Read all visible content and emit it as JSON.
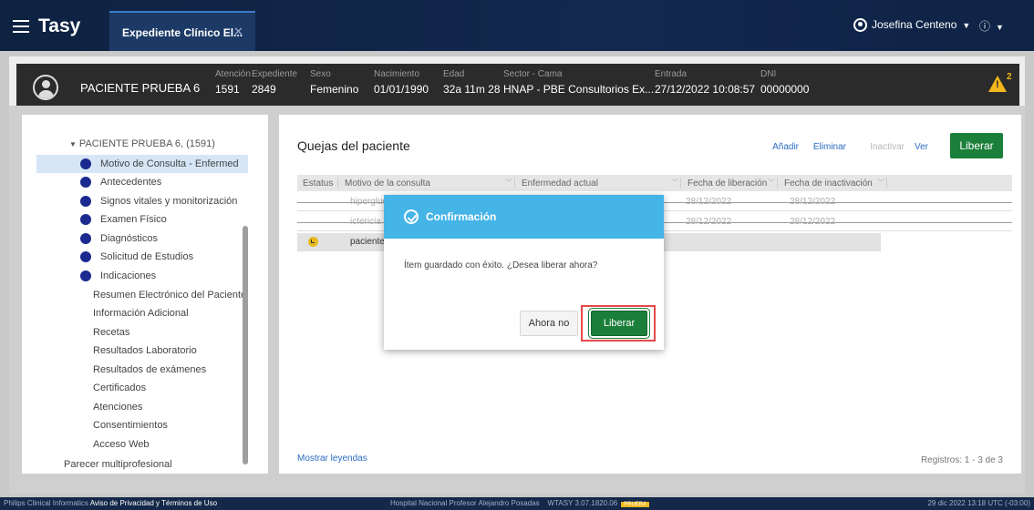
{
  "topbar": {
    "brand": "Tasy",
    "tab_label": "Expediente Clínico El...",
    "tab_close": "✕",
    "user_name": "Josefina Centeno",
    "info_glyph": "ⓘ"
  },
  "patient": {
    "name": "PACIENTE PRUEBA 6",
    "fields": [
      {
        "label": "Atención",
        "value": "1591"
      },
      {
        "label": "Expediente",
        "value": "2849"
      },
      {
        "label": "Sexo",
        "value": "Femenino"
      },
      {
        "label": "Nacimiento",
        "value": "01/01/1990"
      },
      {
        "label": "Edad",
        "value": "32a 11m 28"
      },
      {
        "label": "Sector - Cama",
        "value": "HNAP - PBE Consultorios Ex..."
      },
      {
        "label": "Entrada",
        "value": "27/12/2022 10:08:57"
      },
      {
        "label": "DNI",
        "value": "00000000"
      }
    ],
    "alert_count": "2"
  },
  "sidebar": {
    "root": "PACIENTE PRUEBA 6, (1591)",
    "items": [
      {
        "label": "Motivo de Consulta - Enfermed"
      },
      {
        "label": "Antecedentes"
      },
      {
        "label": "Signos vitales y monitorización"
      },
      {
        "label": "Examen Físico"
      },
      {
        "label": "Diagnósticos"
      },
      {
        "label": "Solicitud de Estudios"
      },
      {
        "label": "Indicaciones"
      }
    ],
    "plain_items": [
      {
        "label": "Resumen Electrónico del Paciente"
      },
      {
        "label": "Información Adicional"
      },
      {
        "label": "Recetas"
      },
      {
        "label": "Resultados Laboratorio"
      },
      {
        "label": "Resultados de exámenes"
      },
      {
        "label": "Certificados"
      },
      {
        "label": "Atenciones"
      },
      {
        "label": "Consentimientos"
      },
      {
        "label": "Acceso Web"
      }
    ],
    "extra": "Parecer multiprofesional"
  },
  "main": {
    "title": "Quejas del paciente",
    "actions": {
      "add": "Añadir",
      "delete": "Eliminar",
      "inactivate": "Inactivar",
      "view": "Ver",
      "release": "Liberar"
    },
    "columns": {
      "status": "Estatus",
      "reason": "Motivo de la consulta",
      "illness": "Enfermedad actual",
      "release_date": "Fecha de liberación",
      "inactivation_date": "Fecha de inactivación"
    },
    "rows": [
      {
        "reason": "hiperglud",
        "release_date": "28/12/2022",
        "inactivation_date": "28/12/2022"
      },
      {
        "reason": "ictericia",
        "release_date": "28/12/2022",
        "inactivation_date": "28/12/2022"
      },
      {
        "reason": "paciente",
        "release_date": "",
        "inactivation_date": ""
      }
    ],
    "legend_link": "Mostrar leyendas",
    "records": "Registros: 1 - 3 de 3"
  },
  "dialog": {
    "title": "Confirmación",
    "message": "Ítem guardado con éxito. ¿Desea liberar ahora?",
    "cancel_label": "Ahora no",
    "confirm_label": "Liberar"
  },
  "footer": {
    "left_prefix": "Philips Clinical Informatics",
    "left_link": "Aviso de Privacidad y Términos de Uso",
    "center": "Hospital Nacional Profesor Alejandro Posadas",
    "version": "WTASY 3.07.1820.06",
    "badge": "PRUEBA",
    "right": "29 dic 2022  13:18  UTC (-03:00)"
  },
  "colors": {
    "topbar": "#0e2242",
    "accent_green": "#1b7f3a",
    "dialog_header": "#45b4e7",
    "link_blue": "#2a6cc3",
    "highlight_red": "#e64a4a",
    "alert_yellow": "#f2b81b"
  }
}
